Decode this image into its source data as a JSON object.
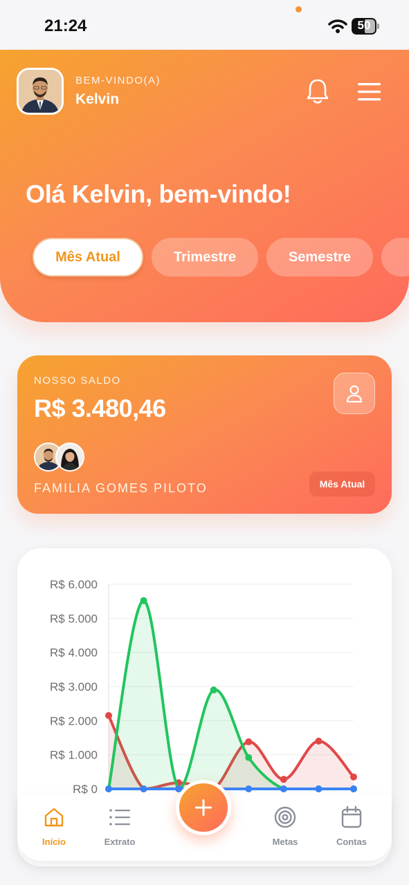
{
  "status_bar": {
    "time": "21:24",
    "battery": "50"
  },
  "header": {
    "welcome_label": "BEM-VINDO(A)",
    "user_name": "Kelvin",
    "greeting": "Olá Kelvin, bem-vindo!",
    "icons": {
      "notifications": "bell-icon",
      "menu": "hamburger-menu-icon"
    }
  },
  "period_tabs": [
    {
      "label": "Mês Atual",
      "active": true
    },
    {
      "label": "Trimestre",
      "active": false
    },
    {
      "label": "Semestre",
      "active": false
    }
  ],
  "balance_card": {
    "label": "NOSSO SALDO",
    "value": "R$ 3.480,46",
    "family_name": "FAMILIA GOMES PILOTO",
    "period_badge": "Mês Atual",
    "members": 2
  },
  "chart_data": {
    "type": "area",
    "y_ticks": [
      "R$ 0",
      "R$ 1.000",
      "R$ 2.000",
      "R$ 3.000",
      "R$ 4.000",
      "R$ 5.000",
      "R$ 6.000"
    ],
    "ylim": [
      0,
      6000
    ],
    "x_points": 8,
    "grid": true,
    "series": [
      {
        "color": "#e04848",
        "values": [
          2150,
          0,
          180,
          0,
          1380,
          280,
          1400,
          350
        ]
      },
      {
        "color": "#22c55e",
        "values": [
          0,
          5520,
          0,
          2900,
          920,
          0,
          0,
          0
        ]
      },
      {
        "color": "#3b82f6",
        "values": [
          0,
          0,
          0,
          0,
          0,
          0,
          0,
          0
        ]
      }
    ]
  },
  "bottom_nav": {
    "items": [
      {
        "label": "Início",
        "icon": "home-icon",
        "active": true
      },
      {
        "label": "Extrato",
        "icon": "list-icon",
        "active": false
      },
      {
        "label": "Metas",
        "icon": "target-icon",
        "active": false
      },
      {
        "label": "Contas",
        "icon": "calendar-icon",
        "active": false
      }
    ],
    "fab_icon": "plus-icon"
  },
  "colors": {
    "accent": "#f0961c",
    "gradient_start": "#f6a32f",
    "gradient_end": "#ff6b5c"
  }
}
